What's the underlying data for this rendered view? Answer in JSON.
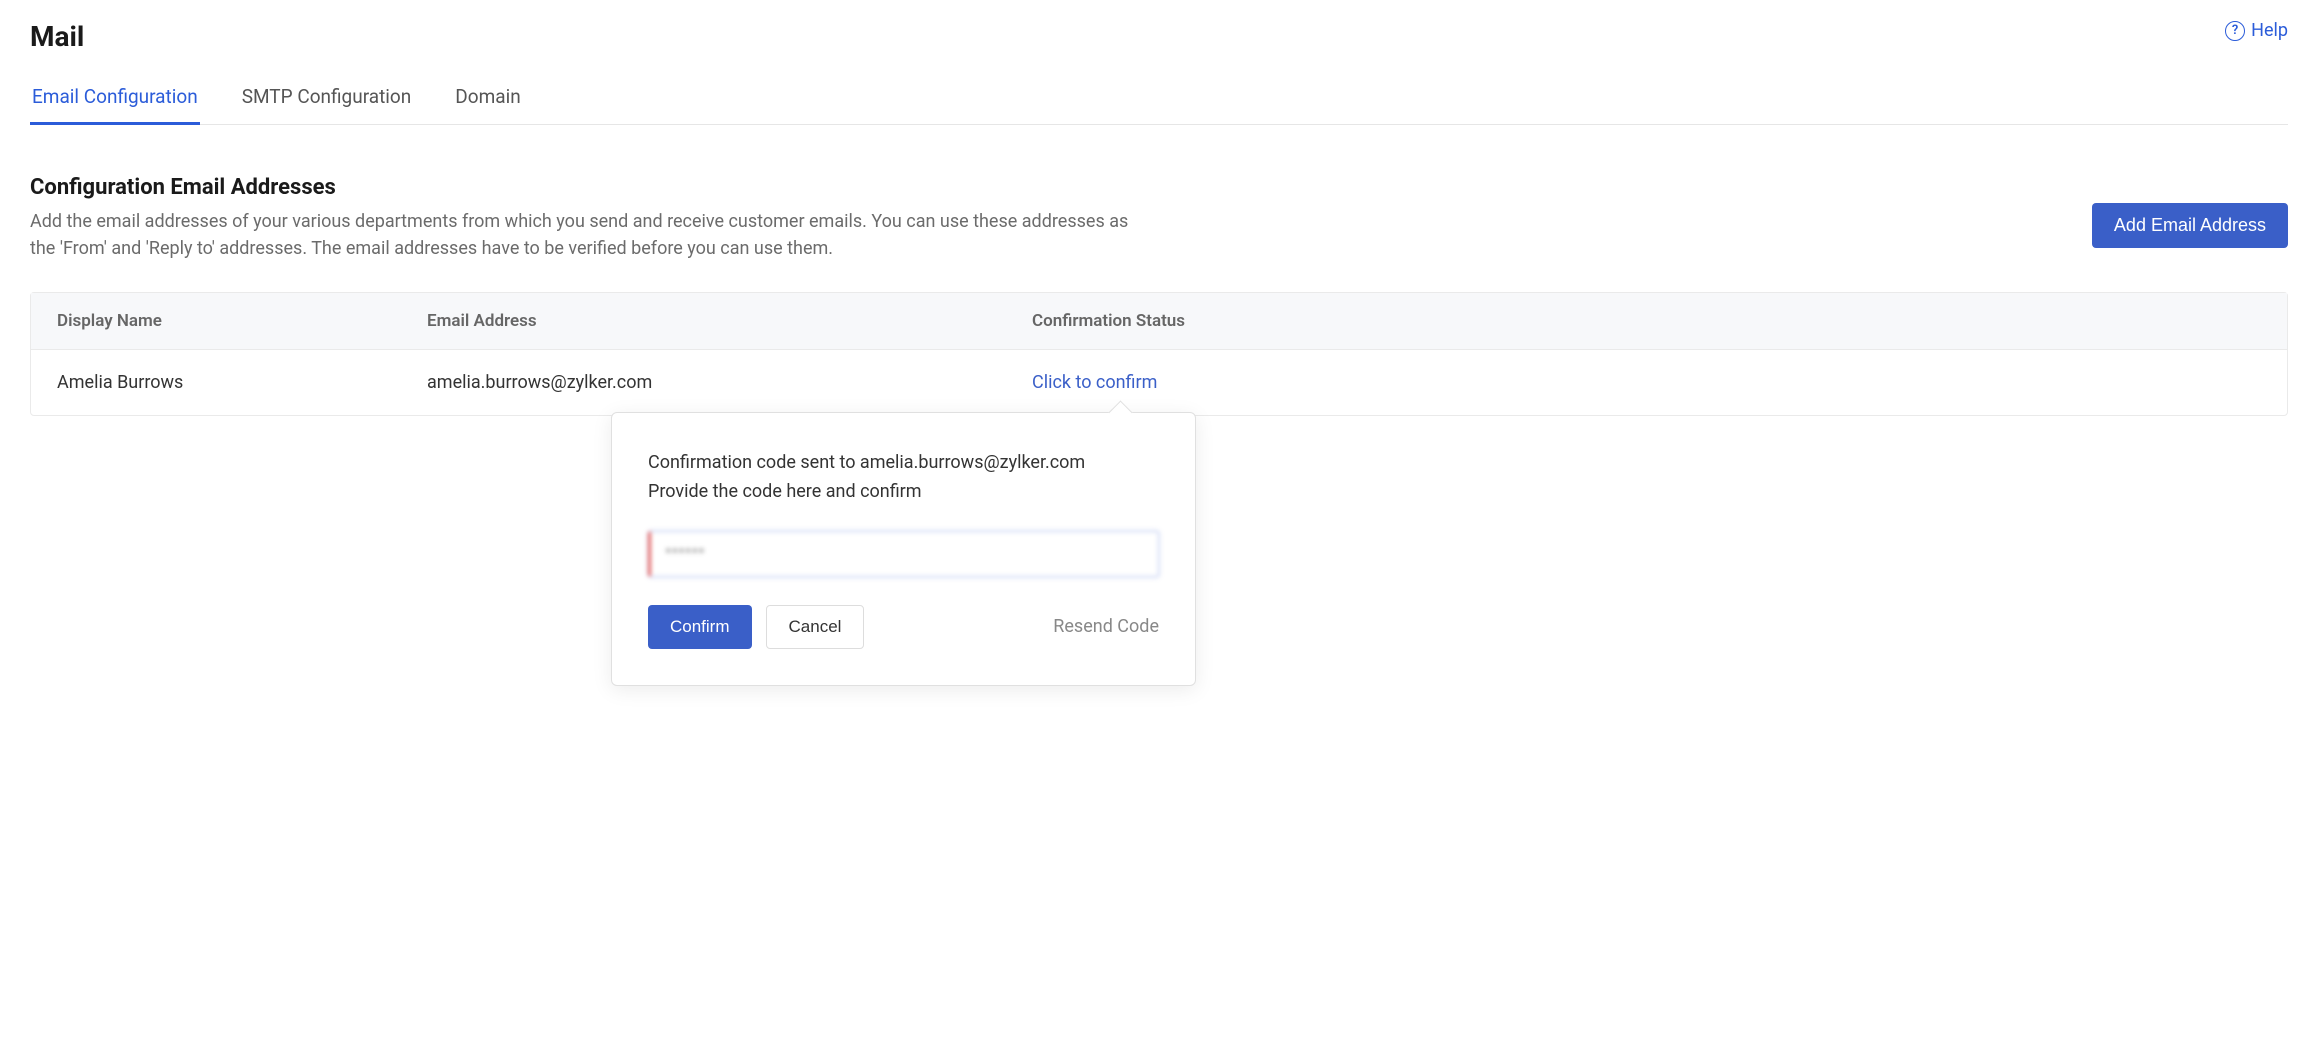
{
  "header": {
    "title": "Mail",
    "help_label": "Help"
  },
  "tabs": {
    "email_config": "Email Configuration",
    "smtp_config": "SMTP Configuration",
    "domain": "Domain"
  },
  "section": {
    "heading": "Configuration Email Addresses",
    "description": "Add the email addresses of your various departments from which you send and receive customer emails. You can use these addresses as the 'From' and 'Reply to' addresses. The email addresses have to be verified before you can use them.",
    "add_button": "Add Email Address"
  },
  "table": {
    "headers": {
      "display_name": "Display Name",
      "email_address": "Email Address",
      "confirmation_status": "Confirmation Status"
    },
    "rows": [
      {
        "display_name": "Amelia Burrows",
        "email_address": "amelia.burrows@zylker.com",
        "status_link": "Click to confirm"
      }
    ]
  },
  "popover": {
    "line1": "Confirmation code sent to amelia.burrows@zylker.com",
    "line2": "Provide the code here and confirm",
    "input_value": "******",
    "confirm_label": "Confirm",
    "cancel_label": "Cancel",
    "resend_label": "Resend Code"
  }
}
